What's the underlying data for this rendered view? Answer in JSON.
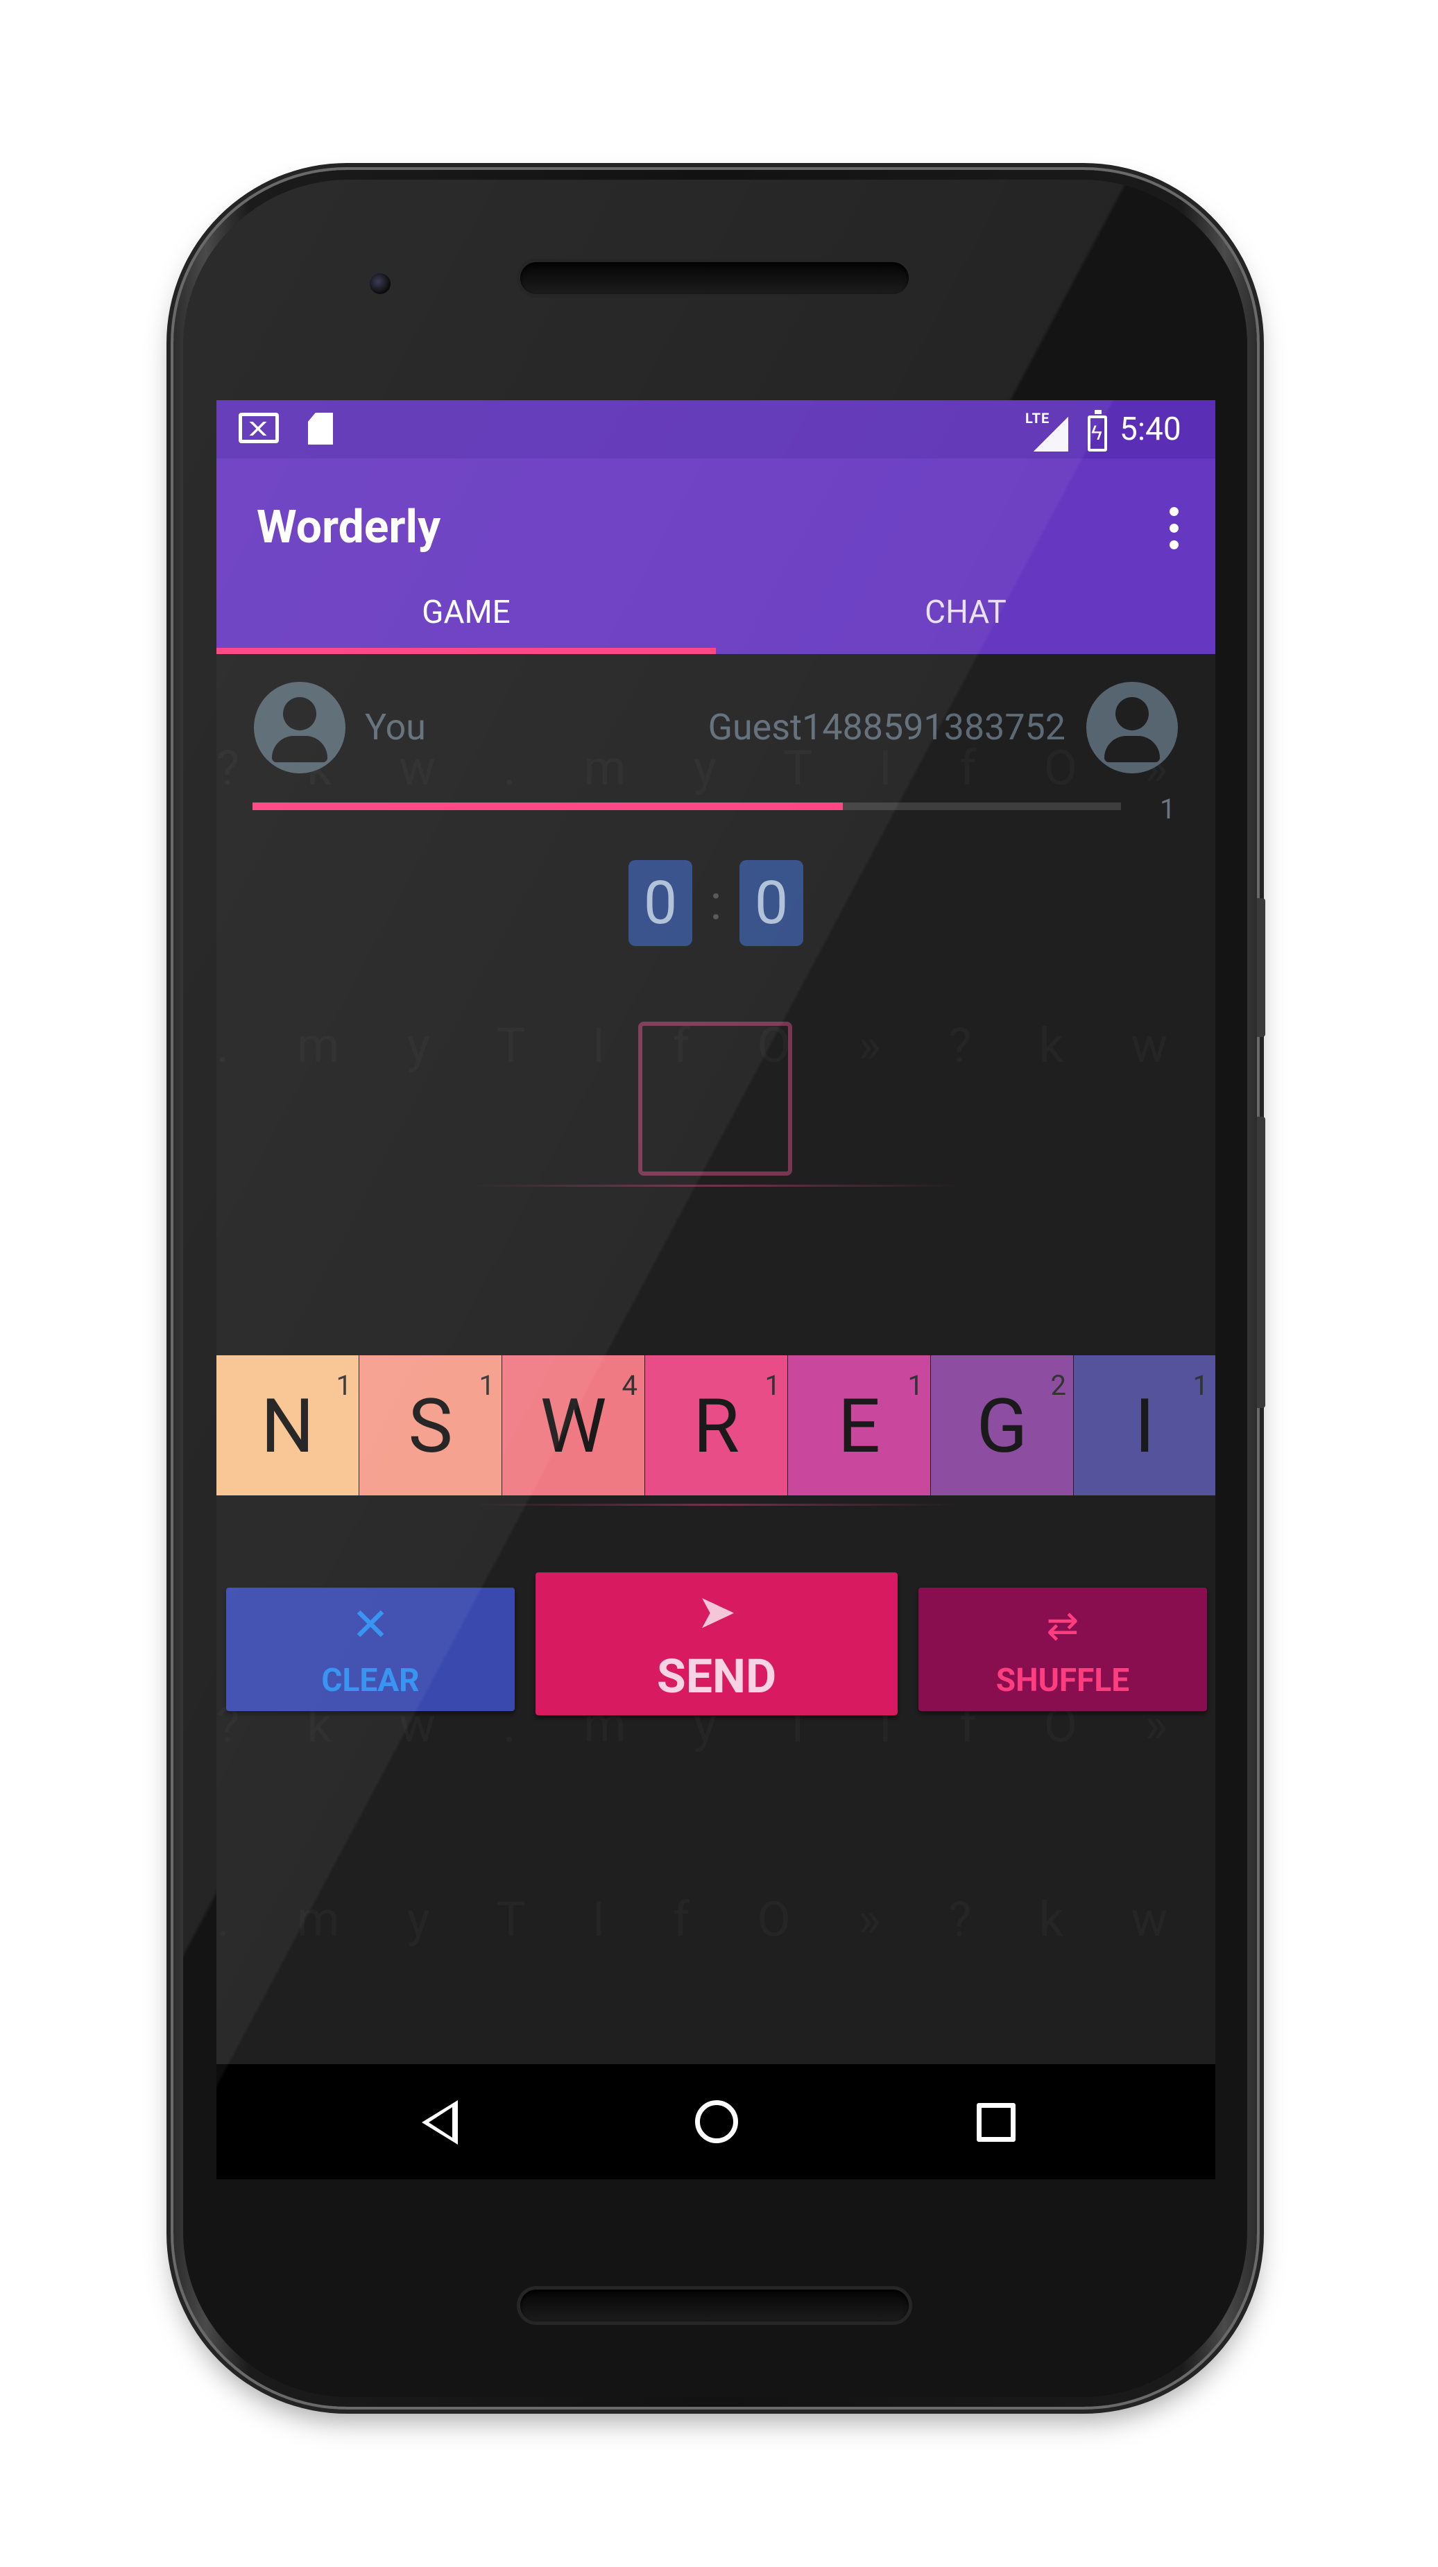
{
  "status_bar": {
    "notification_icons": [
      "gallery-icon",
      "sd-card-icon"
    ],
    "network_label": "LTE",
    "time": "5:40"
  },
  "app_bar": {
    "title": "Worderly",
    "overflow_icon": "more-vert-icon",
    "tabs": [
      {
        "label": "GAME",
        "selected": true
      },
      {
        "label": "CHAT",
        "selected": false
      }
    ]
  },
  "players": {
    "me": {
      "name": "You",
      "avatar_icon": "account-circle-icon"
    },
    "opponent": {
      "name": "Guest1488591383752",
      "avatar_icon": "account-circle-icon"
    }
  },
  "round": {
    "progress_fraction": 0.68,
    "number": "1"
  },
  "score": {
    "me": "0",
    "separator": ":",
    "opponent": "0"
  },
  "tiles": [
    {
      "letter": "N",
      "points": "1",
      "color": "#f9c38f"
    },
    {
      "letter": "S",
      "points": "1",
      "color": "#f69d8b"
    },
    {
      "letter": "W",
      "points": "4",
      "color": "#f07a83"
    },
    {
      "letter": "R",
      "points": "1",
      "color": "#e94d87"
    },
    {
      "letter": "E",
      "points": "1",
      "color": "#c9479c"
    },
    {
      "letter": "G",
      "points": "2",
      "color": "#8d4ea1"
    },
    {
      "letter": "I",
      "points": "1",
      "color": "#55539b"
    }
  ],
  "buttons": {
    "clear": {
      "label": "CLEAR",
      "icon": "close-icon",
      "glyph": "✕"
    },
    "send": {
      "label": "SEND",
      "icon": "send-icon",
      "glyph": "➤"
    },
    "shuffle": {
      "label": "SHUFFLE",
      "icon": "swap-horiz-icon",
      "glyph": "⇄"
    }
  },
  "nav_bar": {
    "back_icon": "nav-back-icon",
    "home_icon": "nav-home-icon",
    "recents_icon": "nav-recents-icon"
  },
  "colors": {
    "status_bar": "#5b2fb5",
    "app_bar": "#6637c0",
    "tab_indicator": "#ff3d7f",
    "progress": "#ff3d7f",
    "score_box": "#2f4a86",
    "clear_button": "#3a49ae",
    "send_button": "#d81b60",
    "shuffle_button": "#880e4f"
  }
}
